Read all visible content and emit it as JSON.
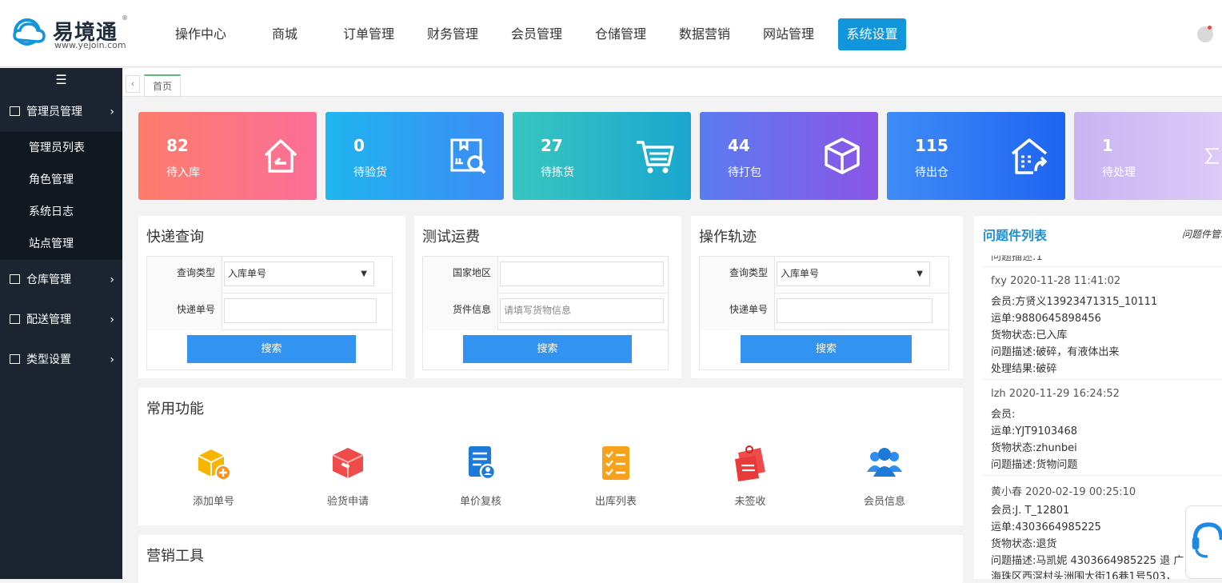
{
  "header": {
    "logo_name": "易境通",
    "logo_reg": "®",
    "logo_url": "www.yejoin.com",
    "nav": [
      "操作中心",
      "商城",
      "订单管理",
      "财务管理",
      "会员管理",
      "仓储管理",
      "数据营销",
      "网站管理",
      "系统设置"
    ],
    "active_nav": "系统设置",
    "accent": "#1296db"
  },
  "sidebar": {
    "toggle_glyph": "☰",
    "groups": [
      {
        "label": "管理员管理",
        "items": [
          "管理员列表",
          "角色管理",
          "系统日志",
          "站点管理"
        ]
      },
      {
        "label": "仓库管理",
        "items": []
      },
      {
        "label": "配送管理",
        "items": []
      },
      {
        "label": "类型设置",
        "items": []
      }
    ],
    "arrow_glyph": "›"
  },
  "tabs": {
    "prev_glyph": "‹",
    "home": "首页"
  },
  "stats": [
    {
      "value": "82",
      "label": "待入库",
      "icon": "house-icon",
      "gradient": [
        "#fb7d6b",
        "#fb6e98"
      ]
    },
    {
      "value": "0",
      "label": "待验货",
      "icon": "inspect-box-icon",
      "gradient": [
        "#1fb5f0",
        "#3c8bf5"
      ]
    },
    {
      "value": "27",
      "label": "待拣货",
      "icon": "cart-icon",
      "gradient": [
        "#37c6c0",
        "#1aa6cf"
      ]
    },
    {
      "value": "44",
      "label": "待打包",
      "icon": "package-icon",
      "gradient": [
        "#5a7cf1",
        "#8b55e6"
      ]
    },
    {
      "value": "115",
      "label": "待出仓",
      "icon": "warehouse-out-icon",
      "gradient": [
        "#3f8cf7",
        "#1e64f0"
      ]
    },
    {
      "value": "1",
      "label": "待处理",
      "icon": "hourglass-icon",
      "gradient": [
        "#c8b4f3",
        "#d9c3f7"
      ]
    }
  ],
  "express_query": {
    "title": "快递查询",
    "type_label": "查询类型",
    "type_value": "入库单号",
    "no_label": "快递单号",
    "no_value": "",
    "search": "搜索"
  },
  "freight_test": {
    "title": "测试运费",
    "country_label": "国家地区",
    "country_value": "",
    "goods_label": "货件信息",
    "goods_placeholder": "请填写货物信息",
    "search": "搜索"
  },
  "track": {
    "title": "操作轨迹",
    "type_label": "查询类型",
    "type_value": "入库单号",
    "no_label": "快递单号",
    "no_value": "",
    "search": "搜索"
  },
  "common": {
    "title": "常用功能",
    "items": [
      {
        "label": "添加单号",
        "icon": "add-box-icon"
      },
      {
        "label": "验货申请",
        "icon": "inspection-box-icon"
      },
      {
        "label": "单价复核",
        "icon": "price-review-icon"
      },
      {
        "label": "出库列表",
        "icon": "checklist-icon"
      },
      {
        "label": "未签收",
        "icon": "unsigned-icon"
      },
      {
        "label": "会员信息",
        "icon": "members-icon"
      }
    ]
  },
  "marketing": {
    "title": "营销工具"
  },
  "issues": {
    "title": "问题件列表",
    "more": "问题件管理",
    "cut_line": "问题描述:1",
    "entries": [
      {
        "header": "fxy  2020-11-28 11:41:02",
        "lines": [
          "会员:方贤义13923471315_10111",
          "运单:9880645898456",
          "货物状态:已入库",
          "问题描述:破碎，有液体出来",
          "处理结果:破碎"
        ]
      },
      {
        "header": "lzh  2020-11-29 16:24:52",
        "lines": [
          "会员:",
          "运单:YJT9103468",
          "货物状态:zhunbei",
          "问题描述:货物问题"
        ]
      },
      {
        "header": "黄小春  2020-02-19 00:25:10",
        "lines": [
          "会员:J. T_12801",
          "运单:4303664985225",
          "货物状态:退货",
          "问题描述:马凯妮 4303664985225 退 广",
          "海珠区西滘村头洲围大街16巷1号503，"
        ]
      }
    ]
  },
  "chat": {
    "icon": "customer-service-icon"
  }
}
